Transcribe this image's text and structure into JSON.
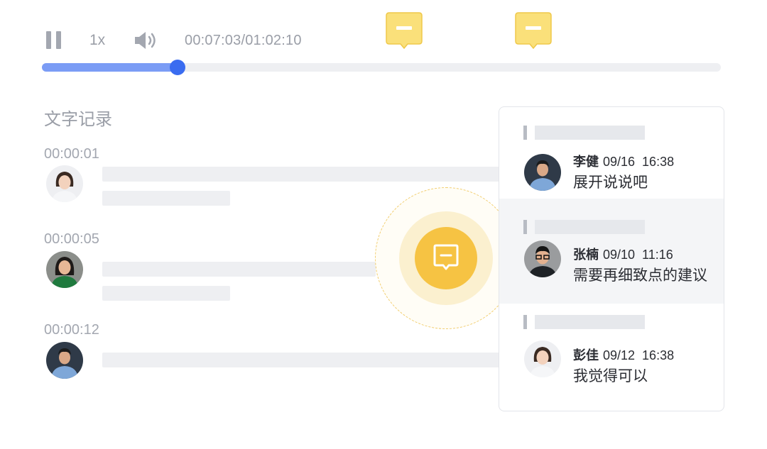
{
  "player": {
    "speed": "1x",
    "current_time": "00:07:03",
    "total_time": "01:02:10",
    "time_display": "00:07:03/01:02:10",
    "progress_percent": 20,
    "colors": {
      "progress": "#7b9cf5",
      "knob": "#3a6cf0",
      "marker": "#f7d35c"
    },
    "icons": [
      "pause-icon",
      "volume-icon",
      "comment-marker-icon"
    ]
  },
  "transcript": {
    "title": "文字记录",
    "entries": [
      {
        "time": "00:00:01",
        "avatar": "avatar-woman-white-shirt"
      },
      {
        "time": "00:00:05",
        "avatar": "avatar-woman-green-top"
      },
      {
        "time": "00:00:12",
        "avatar": "avatar-man-blue-shirt"
      }
    ]
  },
  "focus": {
    "icon": "comment-icon",
    "color": "#f6c343"
  },
  "comments": [
    {
      "name": "李健",
      "date": "09/16",
      "time": "16:38",
      "text": "展开说说吧",
      "active": false
    },
    {
      "name": "张楠",
      "date": "09/10",
      "time": "11:16",
      "text": "需要再细致点的建议",
      "active": true
    },
    {
      "name": "彭佳",
      "date": "09/12",
      "time": "16:38",
      "text": "我觉得可以",
      "active": false
    }
  ]
}
